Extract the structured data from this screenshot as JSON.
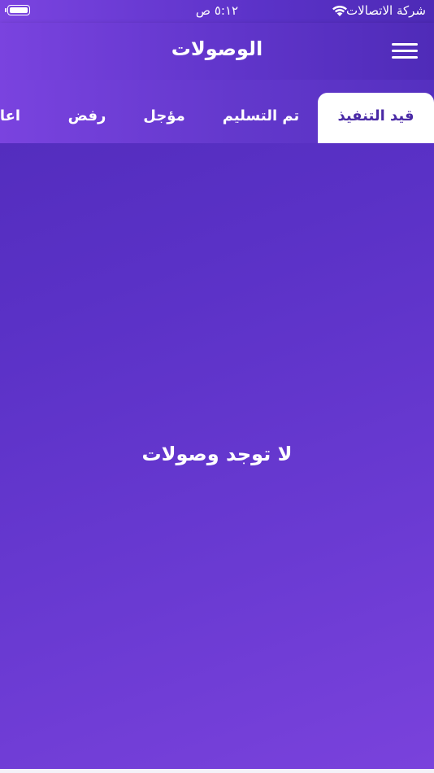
{
  "status_bar": {
    "carrier": "شركة الاتصالات",
    "time": "٥:١٢ ص",
    "icons": [
      "wifi-icon",
      "battery-icon"
    ]
  },
  "header": {
    "title": "الوصولات",
    "menu_icon": "hamburger-menu-icon"
  },
  "tabs": [
    {
      "label": "قيد التنفيذ",
      "active": true
    },
    {
      "label": "تم التسليم",
      "active": false
    },
    {
      "label": "مؤجل",
      "active": false
    },
    {
      "label": "رفض",
      "active": false
    },
    {
      "label": "اعادة",
      "active": false
    }
  ],
  "main": {
    "empty_message": "لا توجد وصولات"
  },
  "colors": {
    "accent": "#5a31c6",
    "active_tab_text": "#4a2aa6",
    "active_tab_bg": "#ffffff"
  }
}
